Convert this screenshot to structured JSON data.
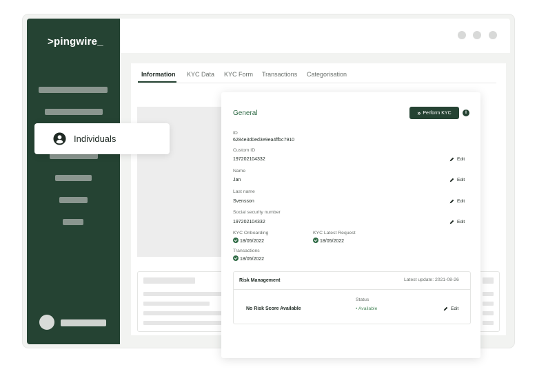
{
  "app": {
    "logo": ">pingwire_"
  },
  "sidebar": {
    "popup_item_label": "Individuals"
  },
  "tabs": [
    {
      "label": "Information",
      "active": true
    },
    {
      "label": "KYC Data"
    },
    {
      "label": "KYC Form"
    },
    {
      "label": "Transactions"
    },
    {
      "label": "Categorisation"
    }
  ],
  "panel": {
    "title": "General",
    "perform_kyc_label": "Perform KYC",
    "info_glyph": "i",
    "fields": [
      {
        "label": "ID",
        "value": "6284e3d0ed3e9ea4ffbc7910"
      },
      {
        "label": "Custom ID",
        "value": "197202104332",
        "edit": "Edit"
      },
      {
        "label": "Name",
        "value": "Jan",
        "edit": "Edit"
      },
      {
        "label": "Last name",
        "value": "Svensson",
        "edit": "Edit"
      },
      {
        "label": "Social security number",
        "value": "197202104332",
        "edit": "Edit"
      }
    ],
    "kyc_onboarding": {
      "label": "KYC Onboarding",
      "value": "18/05/2022"
    },
    "kyc_latest": {
      "label": "KYC Latest Request",
      "value": "18/05/2022"
    },
    "transactions": {
      "label": "Transactions",
      "value": "18/05/2022"
    },
    "risk": {
      "title": "Risk Management",
      "latest_update": "Latest update: 2021-08-26",
      "score_text": "No Risk Score Available",
      "status_label": "Status",
      "status_value": "• Available",
      "edit": "Edit"
    }
  },
  "colors": {
    "sidebar": "#254333",
    "accent": "#2f6a45"
  }
}
